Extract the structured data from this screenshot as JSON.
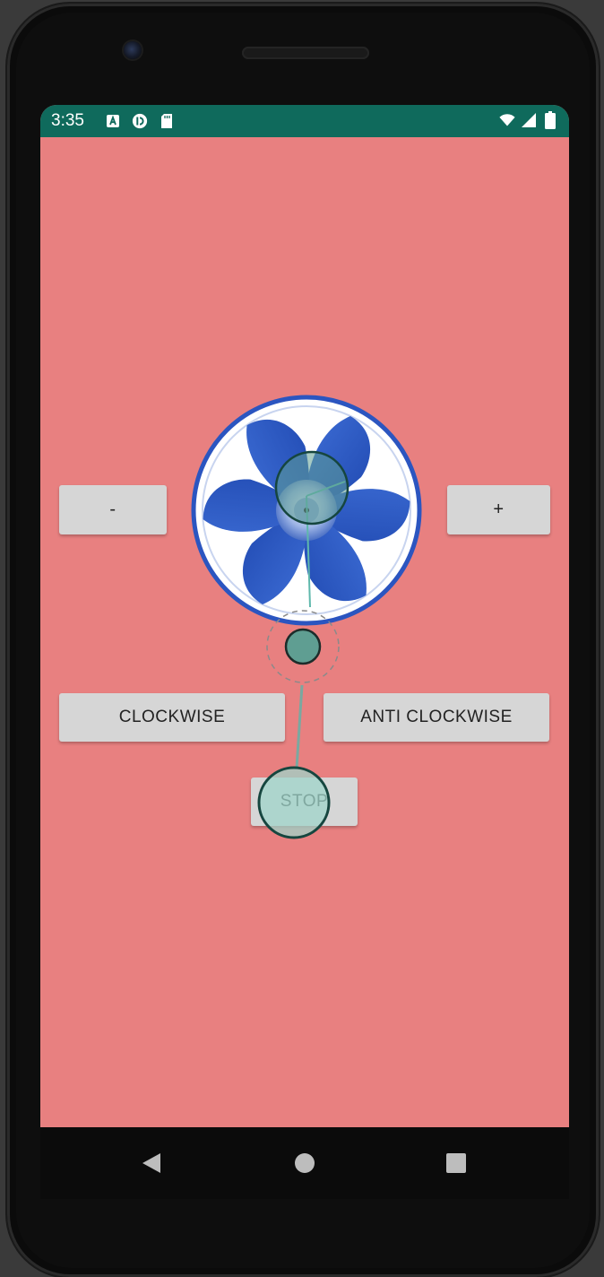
{
  "status_bar": {
    "time": "3:35",
    "left_icons": [
      "a-badge-icon",
      "sync-icon",
      "sd-card-icon"
    ],
    "right_icons": [
      "wifi-icon",
      "cell-signal-icon",
      "battery-icon"
    ]
  },
  "controls": {
    "minus_label": "-",
    "plus_label": "+",
    "clockwise_label": "CLOCKWISE",
    "anticlockwise_label": "ANTI CLOCKWISE",
    "stop_label": "STOP"
  },
  "colors": {
    "screen_background": "#e88080",
    "status_bar": "#0f6a5c",
    "button": "#d6d6d6",
    "fan_blade": "#2d5fc8",
    "touch_indicator": "#5f9e92"
  },
  "nav_bar": {
    "icons": [
      "back-icon",
      "home-icon",
      "recents-icon"
    ]
  }
}
